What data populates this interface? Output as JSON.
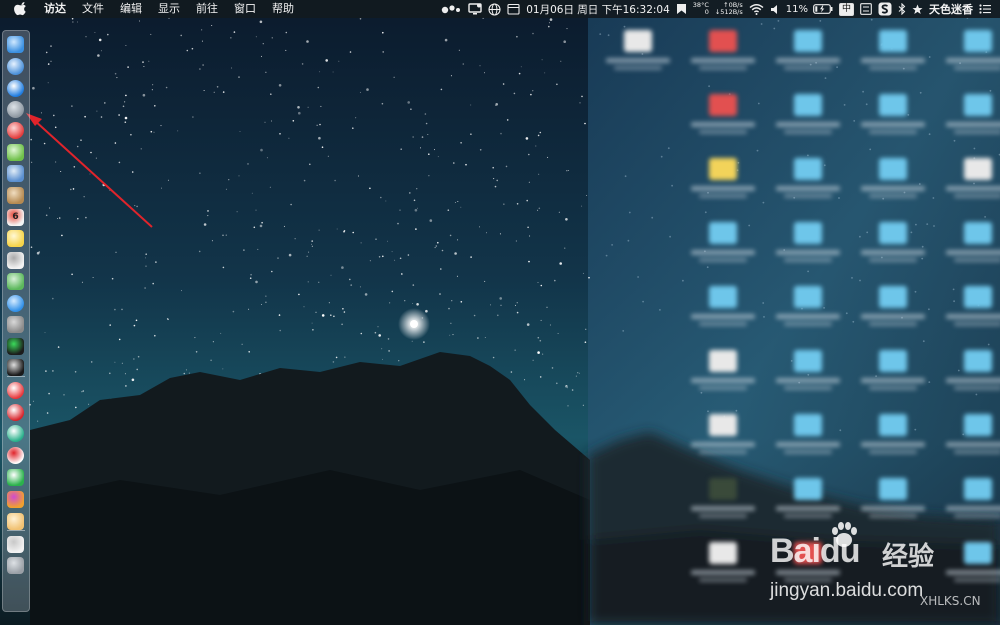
{
  "menubar": {
    "app_name": "访达",
    "menus": [
      "文件",
      "编辑",
      "显示",
      "前往",
      "窗口",
      "帮助"
    ],
    "status": {
      "datetime": "01月06日 周日 下午16:32:04",
      "temperature": "38°C",
      "cpu": "0",
      "net_up": "↑0B/s",
      "net_down": "↓512B/s",
      "battery": "11%",
      "ime": "中",
      "user": "天色迷香"
    }
  },
  "dock": {
    "icons": [
      "finder-icon",
      "network-globe-icon",
      "safari-icon",
      "launchpad-rocket-icon",
      "red-app-icon",
      "android-icon",
      "preview-icon",
      "notes-book-icon",
      "calendar-icon",
      "stickies-icon",
      "reminders-icon",
      "maps-icon",
      "app-store-icon",
      "system-preferences-icon",
      "activity-monitor-icon",
      "terminal-icon",
      "vivaldi-icon",
      "netease-music-icon",
      "green-app-icon",
      "yandex-icon",
      "wechat-icon",
      "photos-icon",
      "folder-icon",
      "document-icon",
      "trash-icon"
    ],
    "calendar_day": "6"
  },
  "watermark": {
    "brand_1": "Bai",
    "brand_2": "du",
    "brand_cn": "经验",
    "url": "jingyan.baidu.com",
    "site": "XHLKS.CN"
  },
  "colors": {
    "arrow": "#e0242b",
    "menubar_bg": "#121a20"
  }
}
